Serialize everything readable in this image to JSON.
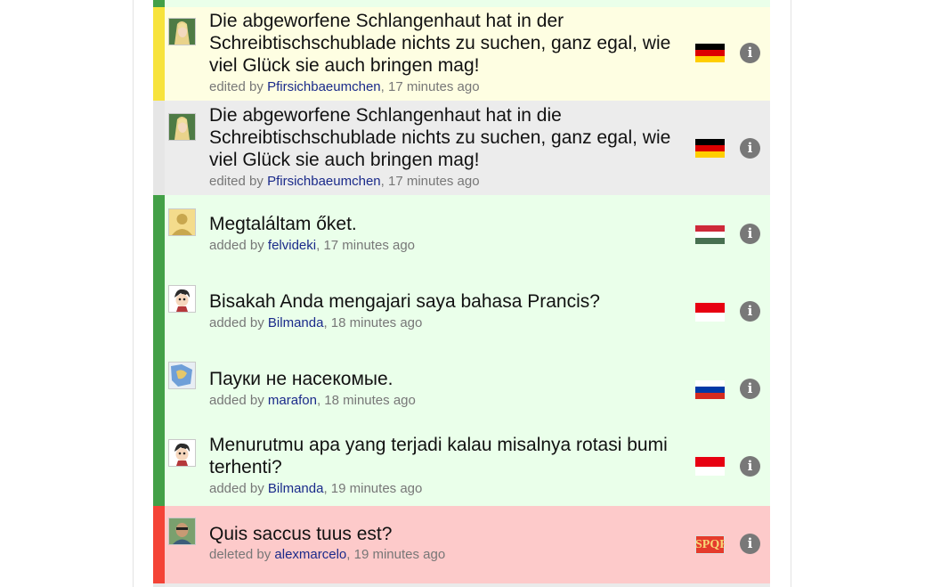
{
  "sentences": [
    {
      "text": "Die abgeworfene Schlangenhaut hat in der Schreibtischschublade nichts zu suchen, ganz egal, wie viel Glück sie auch bringen mag!",
      "action": "edited by",
      "user": "Pfirsichbaeumchen",
      "time": ", 17 minutes ago",
      "flag_icon": "flag-germany-icon",
      "avatar_icon": "avatar-elf-icon",
      "flag_colors": [
        "#000000",
        "#dd0000",
        "#ffce00"
      ]
    },
    {
      "text": "Die abgeworfene Schlangenhaut hat in die Schreibtischschublade nichts zu suchen, ganz egal, wie viel Glück sie auch bringen mag!",
      "action": "edited by",
      "user": "Pfirsichbaeumchen",
      "time": ", 17 minutes ago",
      "flag_icon": "flag-germany-icon",
      "avatar_icon": "avatar-elf-icon",
      "flag_colors": [
        "#000000",
        "#dd0000",
        "#ffce00"
      ]
    },
    {
      "text": "Megtaláltam őket.",
      "action": "added by",
      "user": "felvideki",
      "time": ", 17 minutes ago",
      "flag_icon": "flag-hungary-icon",
      "avatar_icon": "avatar-default-icon",
      "flag_colors": [
        "#ce2939",
        "#ffffff",
        "#477050"
      ]
    },
    {
      "text": "Bisakah Anda mengajari saya bahasa Prancis?",
      "action": "added by",
      "user": "Bilmanda",
      "time": ", 18 minutes ago",
      "flag_icon": "flag-indonesia-icon",
      "avatar_icon": "avatar-cartoon-boy-icon",
      "flag_colors": [
        "#e70011",
        "#ffffff"
      ]
    },
    {
      "text": "Пауки не насекомые.",
      "action": "added by",
      "user": "marafon",
      "time": ", 18 minutes ago",
      "flag_icon": "flag-russia-icon",
      "avatar_icon": "avatar-map-icon",
      "flag_colors": [
        "#ffffff",
        "#0039a6",
        "#d52b1e"
      ]
    },
    {
      "text": "Menurutmu apa yang terjadi kalau misalnya rotasi bumi terhenti?",
      "action": "added by",
      "user": "Bilmanda",
      "time": ", 19 minutes ago",
      "flag_icon": "flag-indonesia-icon",
      "avatar_icon": "avatar-cartoon-boy-icon",
      "flag_colors": [
        "#e70011",
        "#ffffff"
      ]
    },
    {
      "text": "Quis saccus tuus est?",
      "action": "deleted by",
      "user": "alexmarcelo",
      "time": ", 19 minutes ago",
      "flag_icon": "flag-latin-spqr-icon",
      "flag_text": "SPQR",
      "avatar_icon": "avatar-photo-icon",
      "flag_colors": [
        "#e53b2c"
      ]
    }
  ],
  "info_glyph": "i",
  "row_colors": {
    "edited_current": "#fefee2",
    "edited_previous": "#ececec",
    "added": "#eaffea",
    "deleted": "#fdcaca"
  }
}
